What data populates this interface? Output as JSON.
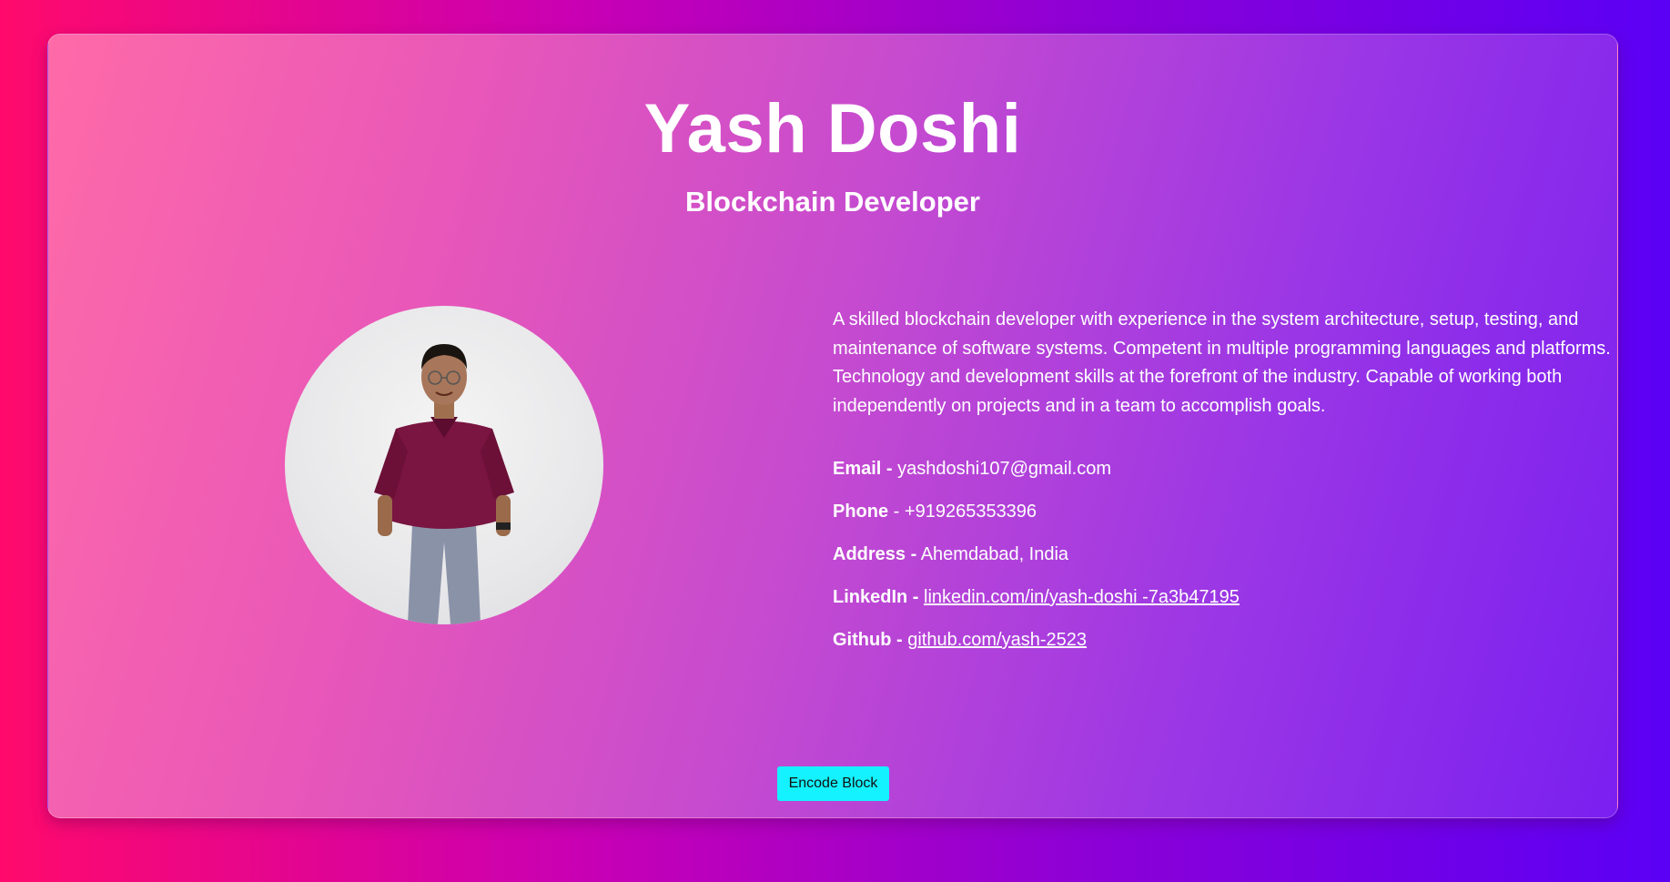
{
  "profile": {
    "name": "Yash Doshi",
    "role": "Blockchain Developer",
    "bio": "A skilled blockchain developer with experience in the system architecture, setup, testing, and maintenance of software systems. Competent in multiple programming languages and platforms. Technology and development skills at the forefront of the industry. Capable of working both independently on projects and in a team to accomplish goals."
  },
  "contact": {
    "email_label": "Email -",
    "email_value": "yashdoshi107@gmail.com",
    "phone_label": "Phone",
    "phone_value": " - +919265353396",
    "address_label": "Address -",
    "address_value": "Ahemdabad, India",
    "linkedin_label": "LinkedIn -",
    "linkedin_value": "linkedin.com/in/yash-doshi -7a3b47195",
    "github_label": "Github -",
    "github_value": "github.com/yash-2523"
  },
  "actions": {
    "encode_label": "Encode Block"
  },
  "colors": {
    "background_start": "#ff0a6c",
    "background_end": "#5b00f5",
    "button": "#14f2ff",
    "text": "#ffffff"
  }
}
